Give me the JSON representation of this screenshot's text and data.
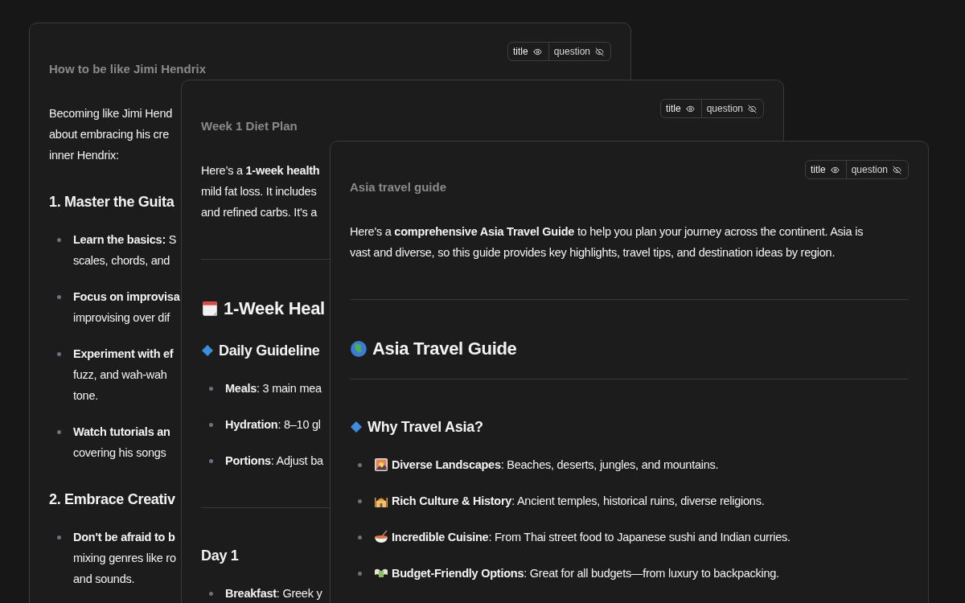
{
  "cards": [
    {
      "title": "How to be like Jimi Hendrix",
      "toggles": [
        {
          "label": "title",
          "visible": true
        },
        {
          "label": "question",
          "visible": false
        }
      ],
      "blocks": [
        {
          "kind": "paragraph",
          "lines": [
            "Becoming like Jimi Hend",
            "about embracing his cre",
            "inner Hendrix:"
          ]
        },
        {
          "kind": "subheading",
          "text": "1. Master the Guita"
        },
        {
          "kind": "list",
          "items": [
            {
              "lines": [
                "**Learn the basics:** S",
                "scales, chords, and"
              ]
            },
            {
              "lines": [
                "**Focus on improvisa**",
                "improvising over dif"
              ]
            },
            {
              "lines": [
                "**Experiment with ef**",
                "fuzz, and wah-wah",
                "tone."
              ]
            },
            {
              "lines": [
                "**Watch tutorials an**",
                "covering his songs"
              ]
            }
          ]
        },
        {
          "kind": "subheading",
          "text": "2. Embrace Creativ"
        },
        {
          "kind": "list",
          "items": [
            {
              "lines": [
                "**Don't be afraid to b**",
                "mixing genres like ro",
                "and sounds."
              ]
            }
          ]
        }
      ]
    },
    {
      "title": "Week 1 Diet Plan",
      "toggles": [
        {
          "label": "title",
          "visible": true
        },
        {
          "label": "question",
          "visible": false
        }
      ],
      "blocks": [
        {
          "kind": "paragraph",
          "lines": [
            "Here’s a **1-week health**",
            "mild fat loss. It includes",
            "and refined carbs. It's a"
          ]
        },
        {
          "kind": "divider"
        },
        {
          "kind": "heading",
          "text": "1-Week Heal"
        },
        {
          "kind": "subheading",
          "text": "Daily Guideline"
        },
        {
          "kind": "list",
          "items": [
            {
              "lines": [
                "**Meals**: 3 main mea"
              ]
            },
            {
              "lines": [
                "**Hydration**: 8–10 gl"
              ]
            },
            {
              "lines": [
                "**Portions**: Adjust ba"
              ]
            }
          ]
        },
        {
          "kind": "divider"
        },
        {
          "kind": "subheading",
          "text": "Day 1"
        },
        {
          "kind": "list",
          "items": [
            {
              "lines": [
                "**Breakfast**: Greek y"
              ]
            }
          ]
        }
      ]
    },
    {
      "title": "Asia travel guide",
      "toggles": [
        {
          "label": "title",
          "visible": true
        },
        {
          "label": "question",
          "visible": false
        }
      ],
      "blocks": [
        {
          "kind": "paragraph",
          "lines": [
            "Here's a **comprehensive Asia Travel Guide** to help you plan your journey across the continent. Asia is",
            "vast and diverse, so this guide provides key highlights, travel tips, and destination ideas by region."
          ]
        },
        {
          "kind": "divider"
        },
        {
          "kind": "heading",
          "text": "Asia Travel Guide"
        },
        {
          "kind": "divider"
        },
        {
          "kind": "subheading",
          "text": "Why Travel Asia?"
        },
        {
          "kind": "list",
          "items": [
            {
              "lines": [
                "**Diverse Landscapes**: Beaches, deserts, jungles, and mountains."
              ]
            },
            {
              "lines": [
                "**Rich Culture & History**: Ancient temples, historical ruins, diverse religions."
              ]
            },
            {
              "lines": [
                "**Incredible Cuisine**: From Thai street food to Japanese sushi and Indian curries."
              ]
            },
            {
              "lines": [
                "**Budget-Friendly Options**: Great for all budgets—from luxury to backpacking."
              ]
            }
          ]
        }
      ]
    }
  ]
}
